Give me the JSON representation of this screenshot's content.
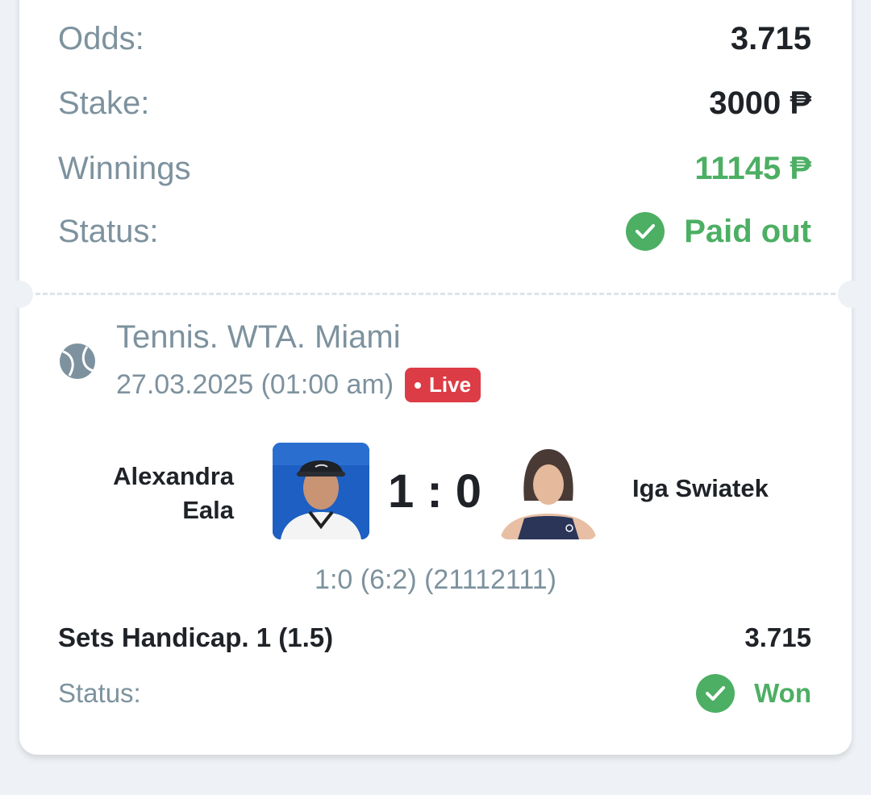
{
  "summary": {
    "odds_label": "Odds:",
    "odds_value": "3.715",
    "stake_label": "Stake:",
    "stake_value": "3000 ₱",
    "winnings_label": "Winnings",
    "winnings_value": "11145 ₱",
    "status_label": "Status:",
    "status_value": "Paid out"
  },
  "event": {
    "sport_icon": "tennis-ball-icon",
    "title": "Tennis. WTA. Miami",
    "date": "27.03.2025 (01:00 am)",
    "live_label": "Live",
    "player1_name": "Alexandra Eala",
    "player2_name": "Iga Swiatek",
    "score": "1 : 0",
    "score_detail": "1:0 (6:2) (21112111)"
  },
  "bet": {
    "market": "Sets Handicap. 1 (1.5)",
    "odds": "3.715",
    "status_label": "Status:",
    "status_value": "Won"
  },
  "colors": {
    "accent_green": "#4caf63",
    "live_red": "#dc3c45",
    "muted_text": "#7d929e"
  }
}
